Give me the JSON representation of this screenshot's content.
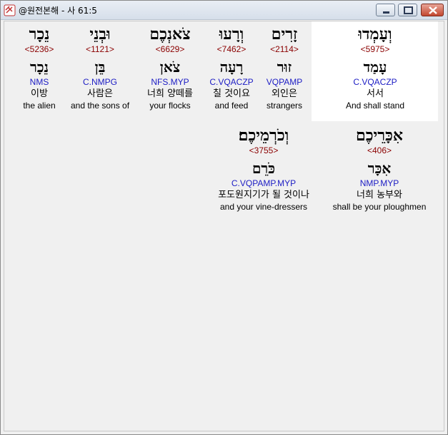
{
  "window": {
    "title": "@원전본해 - 사 61:5",
    "icon": "bible-app-icon"
  },
  "controls": {
    "minimize": "minimize-icon",
    "maximize": "maximize-icon",
    "close": "close-icon"
  },
  "colors": {
    "strong": "#8b0000",
    "parse": "#1c1cc4",
    "highlight": "#ffffff"
  },
  "words": [
    {
      "hebrew": "וְעָמְדוּ",
      "strong": "<5975>",
      "lemma": "עָמַד",
      "parse": "C.VQACZP",
      "korean": "서서",
      "english": "And shall stand",
      "highlighted": true
    },
    {
      "hebrew": "זָרִים",
      "strong": "<2114>",
      "lemma": "זוּר",
      "parse": "VQPAMP",
      "korean": "외인은",
      "english": "strangers"
    },
    {
      "hebrew": "וְרָעוּ",
      "strong": "<7462>",
      "lemma": "רָעָה",
      "parse": "C.VQACZP",
      "korean": "칠 것이요",
      "english": "and feed"
    },
    {
      "hebrew": "צֹאנְכֶם",
      "strong": "<6629>",
      "lemma": "צֹאן",
      "parse": "NFS.MYP",
      "korean": "너희 양떼를",
      "english": "your flocks"
    },
    {
      "hebrew": "וּבְנֵי",
      "strong": "<1121>",
      "lemma": "בֵּן",
      "parse": "C.NMPG",
      "korean": "사람은",
      "english": "and the sons of"
    },
    {
      "hebrew": "נֵכָר",
      "strong": "<5236>",
      "lemma": "נֵכָר",
      "parse": "NMS",
      "korean": "이방",
      "english": "the alien"
    },
    {
      "hebrew": "אִכָּרֵיכֶם",
      "strong": "<406>",
      "lemma": "אִכָּר",
      "parse": "NMP.MYP",
      "korean": "너희 농부와",
      "english": "shall be your ploughmen"
    },
    {
      "hebrew": "וְכֹרְמֵיכֶם׃",
      "strong": "<3755>",
      "lemma": "כֹּרֵם",
      "parse": "C.VQPAMP.MYP",
      "korean": "포도원지기가 될 것이나",
      "english": "and your vine-dressers"
    }
  ]
}
